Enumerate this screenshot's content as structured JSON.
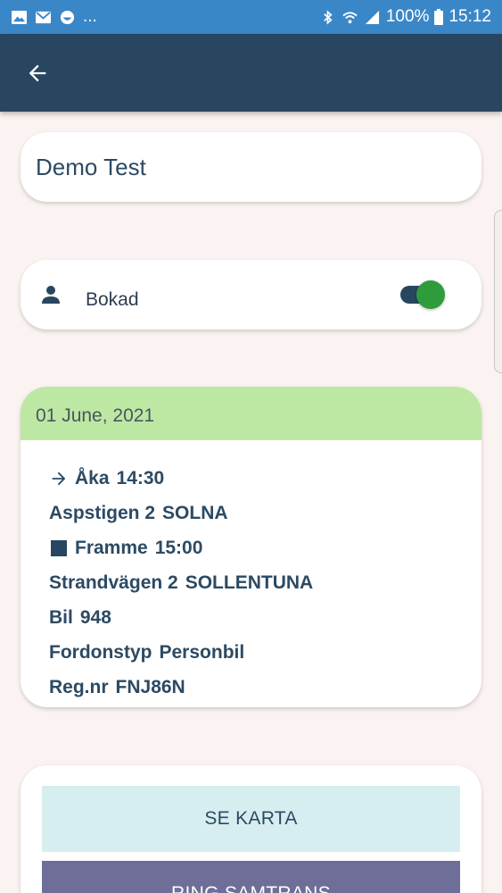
{
  "status_bar": {
    "battery_percent": "100%",
    "time": "15:12",
    "overflow_indicator": "...",
    "icons": [
      "gallery-icon",
      "mail-icon",
      "emoji-icon",
      "bluetooth-icon",
      "wifi-icon",
      "signal-icon",
      "battery-icon"
    ]
  },
  "app_bar": {
    "back_icon": "arrow-left-icon",
    "background_color": "#284660"
  },
  "passenger": {
    "name": "Demo Test"
  },
  "booking_status": {
    "icon": "person-icon",
    "label": "Bokad",
    "toggle_on": true,
    "toggle_color": "#2e9c3a"
  },
  "trip": {
    "date": "01 June, 2021",
    "header_color": "#bde8a3",
    "departure": {
      "icon": "arrow-right-icon",
      "label": "Åka",
      "time": "14:30"
    },
    "from_address": {
      "street": "Aspstigen 2",
      "city": "SOLNA"
    },
    "arrival": {
      "icon": "square-icon",
      "label": "Framme",
      "time": "15:00"
    },
    "to_address": {
      "street": "Strandvägen 2",
      "city": "SOLLENTUNA"
    },
    "vehicle": {
      "label": "Bil",
      "value": "948"
    },
    "vehicle_type": {
      "label": "Fordonstyp",
      "value": "Personbil"
    },
    "registration": {
      "label": "Reg.nr",
      "value": "FNJ86N"
    }
  },
  "actions": {
    "map_button": "SE KARTA",
    "call_button": "RING SAMTRANS",
    "map_button_color": "#d6eef0",
    "call_button_color": "#6f6e99"
  }
}
